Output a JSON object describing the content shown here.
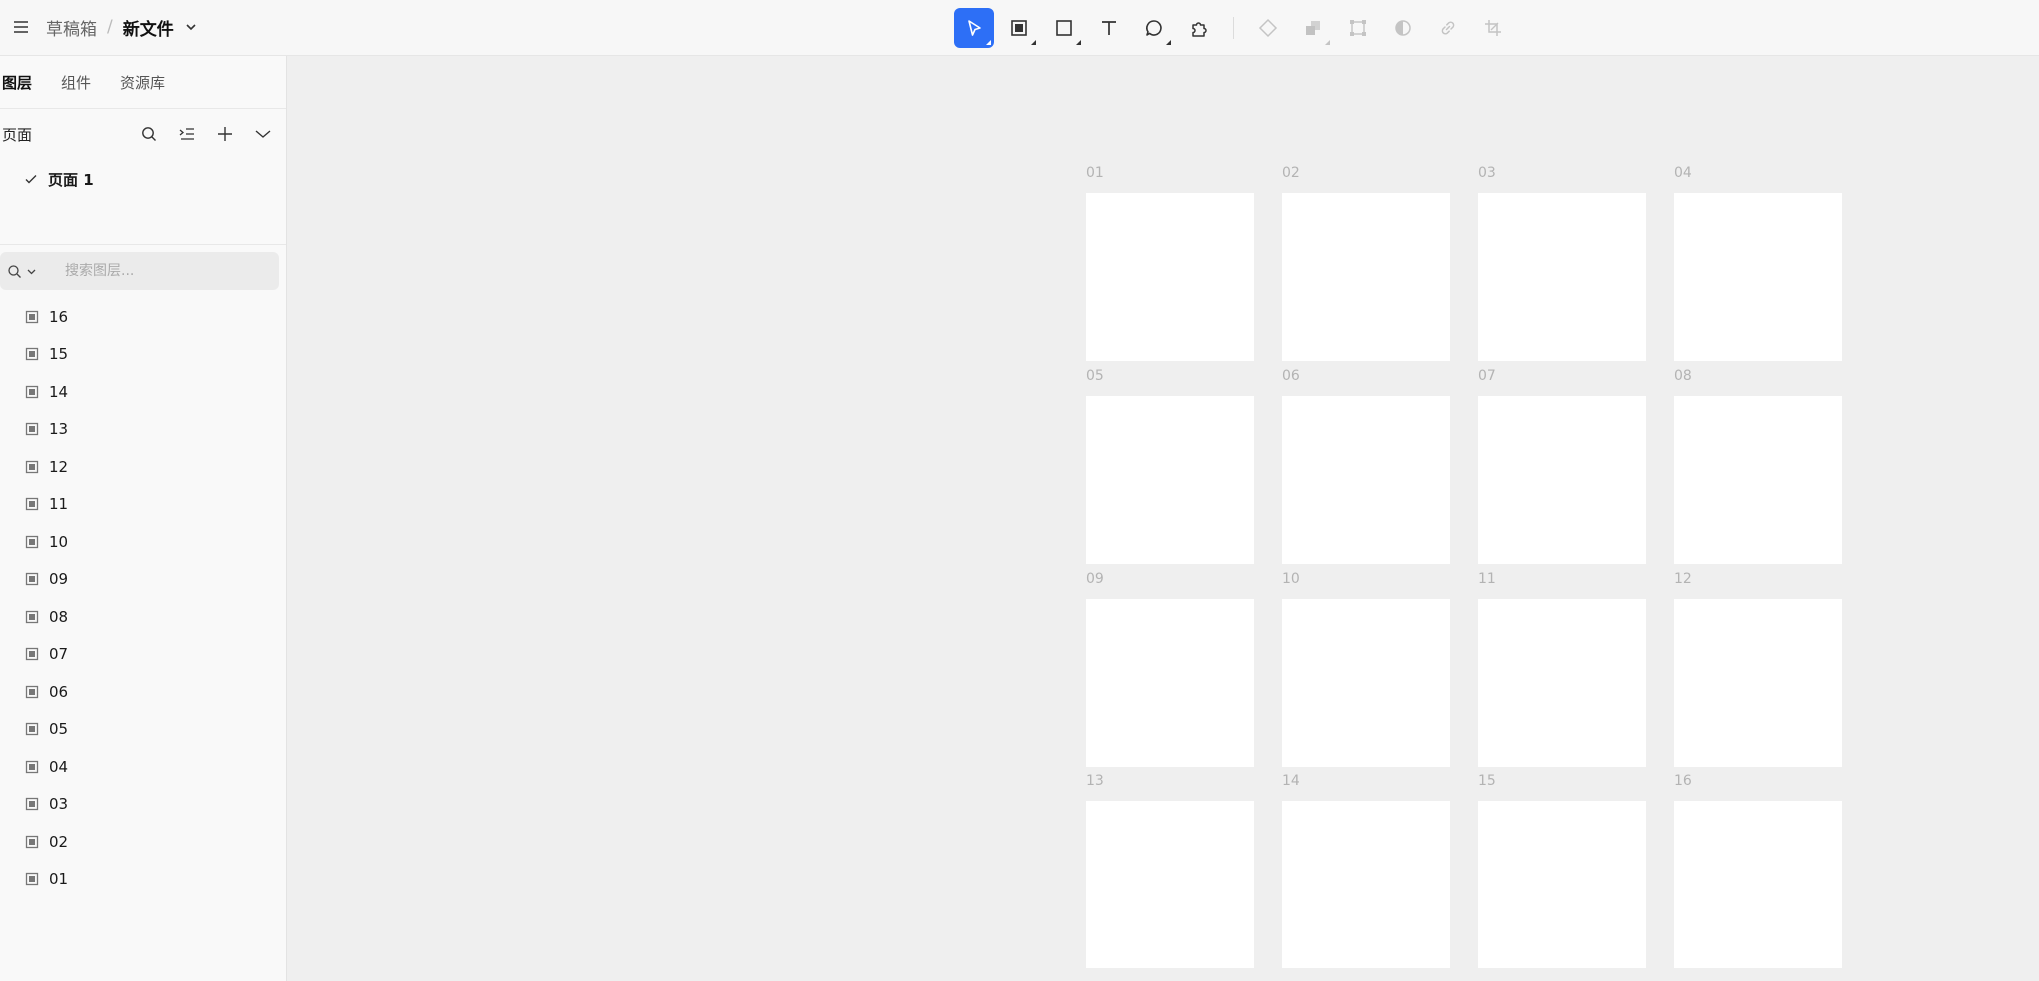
{
  "header": {
    "folder": "草稿箱",
    "separator": "/",
    "file_name": "新文件"
  },
  "toolbar": {
    "tools": [
      {
        "name": "move-tool",
        "icon": "cursor-arrow-icon",
        "active": true
      },
      {
        "name": "frame-tool",
        "icon": "frame-icon"
      },
      {
        "name": "rectangle-tool",
        "icon": "rectangle-icon"
      },
      {
        "name": "text-tool",
        "icon": "text-icon"
      },
      {
        "name": "comment-tool",
        "icon": "comment-icon"
      },
      {
        "name": "plugin-tool",
        "icon": "puzzle-icon"
      }
    ],
    "actions": [
      {
        "name": "create-component",
        "icon": "component-icon",
        "enabled": false
      },
      {
        "name": "boolean-ops",
        "icon": "boolean-icon",
        "enabled": false
      },
      {
        "name": "path-edit",
        "icon": "vector-edit-icon",
        "enabled": false
      },
      {
        "name": "mask",
        "icon": "mask-icon",
        "enabled": false
      },
      {
        "name": "link",
        "icon": "link-icon",
        "enabled": false
      },
      {
        "name": "crop",
        "icon": "crop-icon",
        "enabled": false
      }
    ],
    "accent_color": "#2d6ff6"
  },
  "sidebar": {
    "tabs": [
      "图层",
      "组件",
      "资源库"
    ],
    "pages_title": "页面",
    "pages": [
      {
        "label": "页面 1",
        "current": true
      }
    ],
    "search_placeholder": "搜索图层...",
    "layers": [
      "16",
      "15",
      "14",
      "13",
      "12",
      "11",
      "10",
      "09",
      "08",
      "07",
      "06",
      "05",
      "04",
      "03",
      "02",
      "01"
    ]
  },
  "canvas": {
    "frames": [
      "01",
      "02",
      "03",
      "04",
      "05",
      "06",
      "07",
      "08",
      "09",
      "10",
      "11",
      "12",
      "13",
      "14",
      "15",
      "16"
    ]
  }
}
